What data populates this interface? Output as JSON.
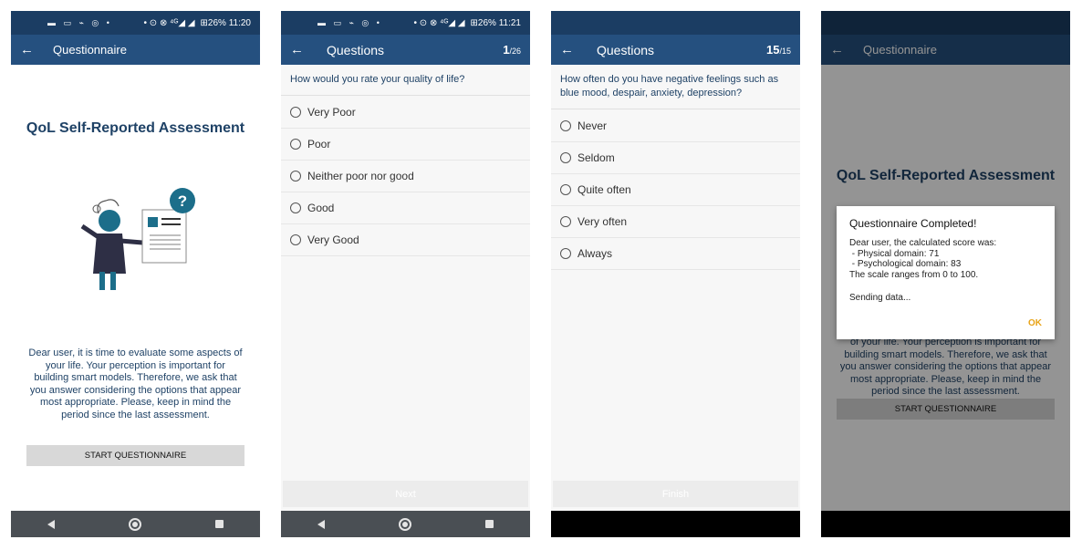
{
  "screen1": {
    "status_icons_left": "▬ ▭ ⌁ ◎ •",
    "status_icons_right": "• ⊙ ⊗ ⁴ᴳ◢ ◢",
    "status_battery_time": "⊞26% 11:20",
    "title": "Questionnaire",
    "assessment_title": "QoL Self-Reported Assessment",
    "intro": "Dear user, it is time to evaluate some aspects of your life. Your perception is important for building smart models. Therefore, we ask that you answer considering the options that appear most appropriate. Please, keep in mind the period since the last assessment.",
    "start_button": "START QUESTIONNAIRE"
  },
  "screen2": {
    "status_icons_left": "▬ ▭ ⌁ ◎ •",
    "status_icons_right": "• ⊙ ⊗ ⁴ᴳ◢ ◢",
    "status_battery_time": "⊞26% 11:21",
    "title": "Questions",
    "counter_current": "1",
    "counter_total": "/26",
    "question": "How would you rate your quality of life?",
    "options": [
      "Very Poor",
      "Poor",
      "Neither poor nor good",
      "Good",
      "Very Good"
    ],
    "action_button": "Next"
  },
  "screen3": {
    "title": "Questions",
    "counter_current": "15",
    "counter_total": "/15",
    "question": "How often do you have negative feelings such as blue mood, despair, anxiety, depression?",
    "options": [
      "Never",
      "Seldom",
      "Quite often",
      "Very often",
      "Always"
    ],
    "action_button": "Finish"
  },
  "screen4": {
    "title": "Questionnaire",
    "assessment_title": "QoL Self-Reported Assessment",
    "intro_visible": "of your life. Your perception is important for building smart models. Therefore, we ask that you answer considering the options that appear most appropriate. Please, keep in mind the period since the last assessment.",
    "start_button": "START QUESTIONNAIRE",
    "dialog": {
      "title": "Questionnaire Completed!",
      "line1": "Dear user, the calculated score was:",
      "line2": " - Physical domain: 71",
      "line3": " - Psychological domain: 83",
      "line4": "The scale ranges from 0 to 100.",
      "sending": "Sending data...",
      "ok": "OK"
    }
  },
  "icons": {
    "back": "←",
    "nav_back": "back-triangle",
    "nav_home": "home-circle",
    "nav_recent": "recent-square"
  },
  "colors": {
    "statusbar": "#1b3d63",
    "appbar": "#25507f",
    "title_text": "#1f4266",
    "ok": "#e8a317"
  }
}
